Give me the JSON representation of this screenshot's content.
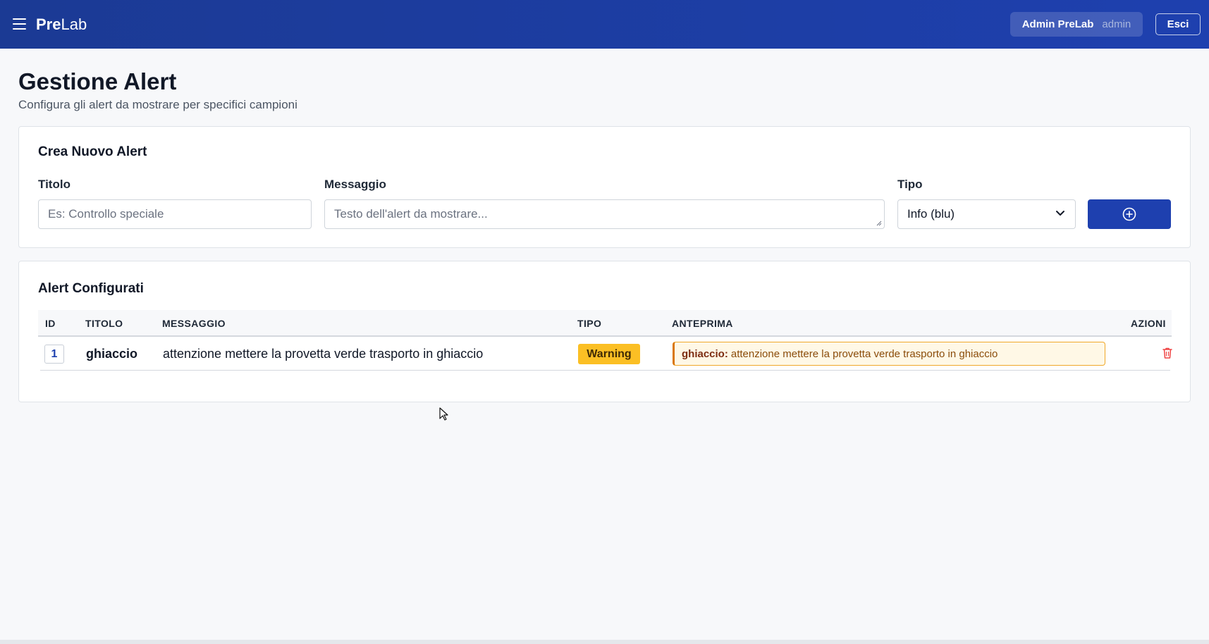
{
  "header": {
    "brand_bold": "Pre",
    "brand_light": "Lab",
    "user_name": "Admin PreLab",
    "user_role": "admin",
    "logout_label": "Esci"
  },
  "page": {
    "title": "Gestione Alert",
    "subtitle": "Configura gli alert da mostrare per specifici campioni"
  },
  "create_form": {
    "title": "Crea Nuovo Alert",
    "title_label": "Titolo",
    "title_placeholder": "Es: Controllo speciale",
    "message_label": "Messaggio",
    "message_placeholder": "Testo dell'alert da mostrare...",
    "type_label": "Tipo",
    "type_selected": "Info (blu)",
    "add_icon": "plus-circle-icon"
  },
  "alerts_table": {
    "title": "Alert Configurati",
    "columns": [
      "ID",
      "TITOLO",
      "MESSAGGIO",
      "TIPO",
      "ANTEPRIMA",
      "AZIONI"
    ],
    "rows": [
      {
        "id": "1",
        "title": "ghiaccio",
        "message": "attenzione mettere la provetta verde trasporto in ghiaccio",
        "type": "Warning",
        "preview_title": "ghiaccio:",
        "preview_message": "attenzione mettere la provetta verde trasporto in ghiaccio",
        "action_icon": "trash-icon"
      }
    ]
  },
  "colors": {
    "primary": "#1e40af",
    "warning": "#fbbf24",
    "danger": "#ef4444"
  }
}
